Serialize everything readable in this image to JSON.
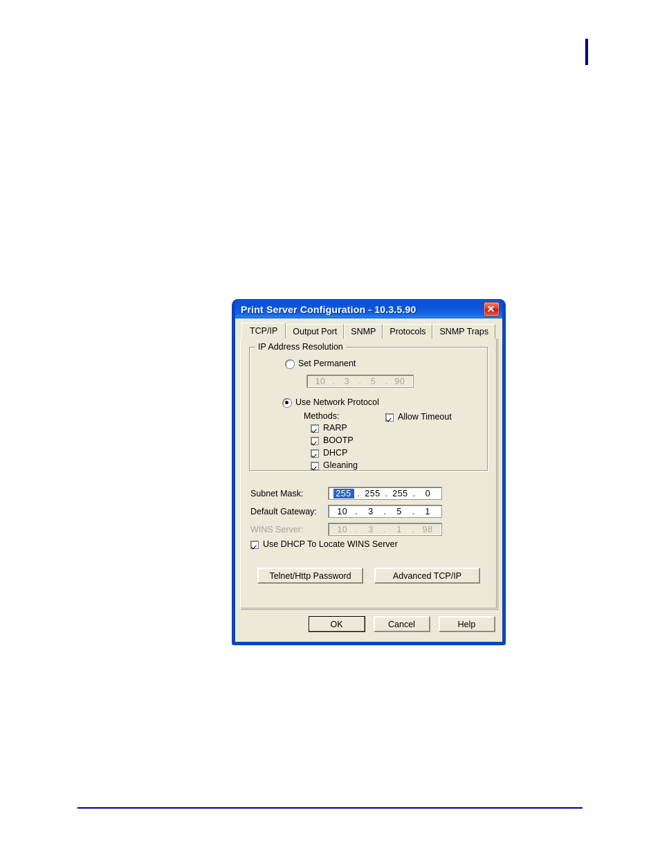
{
  "page": {
    "margin_mark": "vertical-rule",
    "accent_color": "#000080"
  },
  "dialog": {
    "title": "Print Server Configuration - 10.3.5.90",
    "close_label": "Close",
    "titlebar_color": "#0a52d8",
    "body_color": "#ece9d8",
    "tabs": [
      {
        "label": "TCP/IP",
        "active": true
      },
      {
        "label": "Output Port",
        "active": false
      },
      {
        "label": "SNMP",
        "active": false
      },
      {
        "label": "Protocols",
        "active": false
      },
      {
        "label": "SNMP Traps",
        "active": false
      }
    ],
    "tcpip": {
      "group_title": "IP Address Resolution",
      "set_permanent": {
        "label": "Set Permanent",
        "selected": false,
        "ip": {
          "o1": "10",
          "o2": "3",
          "o3": "5",
          "o4": "90",
          "disabled": true
        }
      },
      "use_network_protocol": {
        "label": "Use Network Protocol",
        "selected": true
      },
      "methods_label": "Methods:",
      "methods": [
        {
          "label": "RARP",
          "checked": true
        },
        {
          "label": "BOOTP",
          "checked": true
        },
        {
          "label": "DHCP",
          "checked": true
        },
        {
          "label": "Gleaning",
          "checked": true
        }
      ],
      "allow_timeout": {
        "label": "Allow Timeout",
        "checked": true
      },
      "subnet_mask": {
        "label": "Subnet Mask:",
        "o1": "255",
        "o2": "255",
        "o3": "255",
        "o4": "0",
        "disabled": false,
        "selected_octet": 1
      },
      "default_gateway": {
        "label": "Default Gateway:",
        "o1": "10",
        "o2": "3",
        "o3": "5",
        "o4": "1",
        "disabled": false
      },
      "wins_server": {
        "label": "WINS Server:",
        "o1": "10",
        "o2": "3",
        "o3": "1",
        "o4": "98",
        "disabled": true
      },
      "use_dhcp_wins": {
        "label": "Use DHCP To Locate WINS Server",
        "checked": true
      },
      "telnet_button": "Telnet/Http Password",
      "advanced_button": "Advanced TCP/IP"
    },
    "footer": {
      "ok": "OK",
      "cancel": "Cancel",
      "help": "Help"
    },
    "separators": {
      "dot": "."
    }
  }
}
